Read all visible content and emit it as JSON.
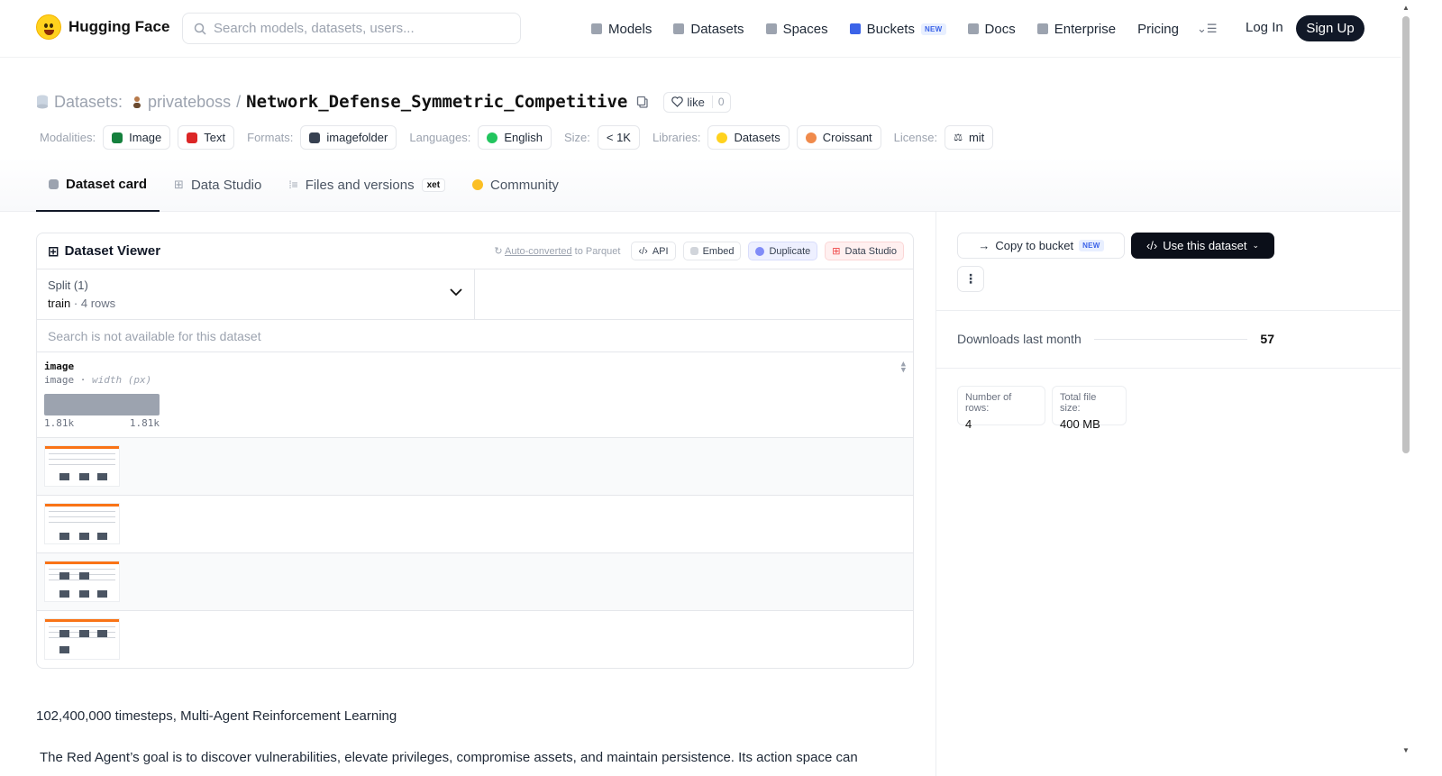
{
  "header": {
    "brand": "Hugging Face",
    "search_placeholder": "Search models, datasets, users...",
    "nav": [
      {
        "label": "Models"
      },
      {
        "label": "Datasets"
      },
      {
        "label": "Spaces"
      },
      {
        "label": "Buckets",
        "badge": "NEW"
      },
      {
        "label": "Docs"
      },
      {
        "label": "Enterprise"
      },
      {
        "label": "Pricing"
      }
    ],
    "login": "Log In",
    "signup": "Sign Up"
  },
  "dataset": {
    "section": "Datasets:",
    "owner": "privateboss",
    "separator": "/",
    "name": "Network_Defense_Symmetric_Competitive",
    "like_label": "like",
    "like_count": "0"
  },
  "tags": {
    "modalities_label": "Modalities:",
    "modalities": [
      "Image",
      "Text"
    ],
    "formats_label": "Formats:",
    "formats": [
      "imagefolder"
    ],
    "languages_label": "Languages:",
    "languages": [
      "English"
    ],
    "size_label": "Size:",
    "size": "< 1K",
    "libraries_label": "Libraries:",
    "libraries": [
      "Datasets",
      "Croissant"
    ],
    "license_label": "License:",
    "license": "mit"
  },
  "tabs": [
    {
      "label": "Dataset card",
      "active": true
    },
    {
      "label": "Data Studio"
    },
    {
      "label": "Files and versions",
      "badge": "xet"
    },
    {
      "label": "Community"
    }
  ],
  "viewer": {
    "title": "Dataset Viewer",
    "auto_converted_link": "Auto-converted",
    "auto_converted_suffix": " to Parquet",
    "actions": [
      "API",
      "Embed",
      "Duplicate",
      "Data Studio"
    ],
    "split_label": "Split (1)",
    "split_value": "train",
    "split_dot": "·",
    "split_rows": "4 rows",
    "search_na": "Search is not available for this dataset",
    "column": {
      "name": "image",
      "type": "image",
      "dot": "·",
      "subtype": "width (px)",
      "min": "1.81k",
      "max": "1.81k"
    },
    "row_count": 4
  },
  "description": {
    "line1": "102,400,000 timesteps, Multi-Agent Reinforcement Learning",
    "line2": "The Red Agent’s goal is to discover vulnerabilities, elevate privileges, compromise assets, and maintain persistence. Its action space can"
  },
  "sidebar": {
    "copy_label": "Copy to bucket",
    "copy_badge": "NEW",
    "use_label": "Use this dataset",
    "more_label": "⋮",
    "downloads_label": "Downloads last month",
    "downloads_value": "57",
    "rows_label": "Number of rows:",
    "rows_value": "4",
    "size_label": "Total file size:",
    "size_value": "400 MB"
  },
  "colors": {
    "accent": "#ffd21e",
    "dark": "#111827",
    "orange": "#f97316"
  }
}
